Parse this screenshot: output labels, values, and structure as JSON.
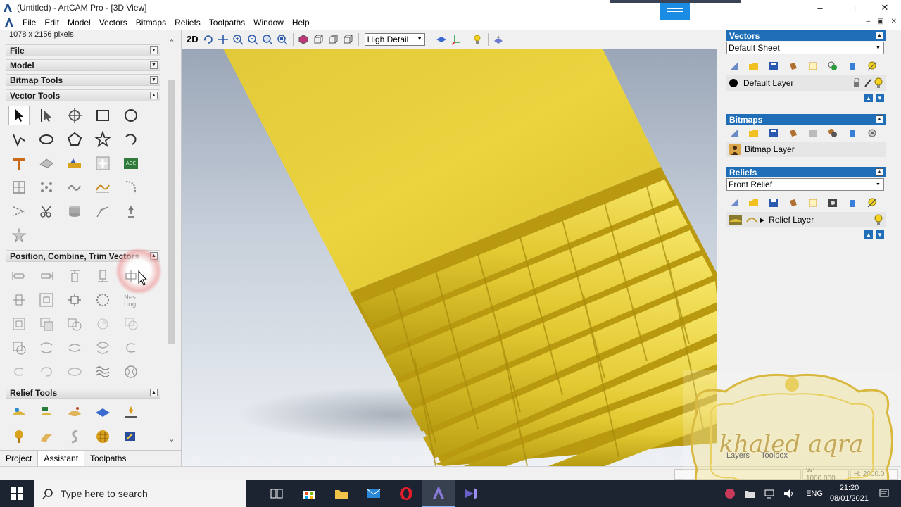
{
  "window": {
    "title": "(Untitled) - ArtCAM Pro - [3D View]",
    "controls": [
      "–",
      "□",
      "✕"
    ],
    "mdi_controls": [
      "–",
      "▣",
      "✕"
    ]
  },
  "menu": {
    "items": [
      "File",
      "Edit",
      "Model",
      "Vectors",
      "Bitmaps",
      "Reliefs",
      "Toolpaths",
      "Window",
      "Help"
    ]
  },
  "left_panel": {
    "pixel_info": "1078 x 2156 pixels",
    "sections": {
      "file": "File",
      "model": "Model",
      "bitmap_tools": "Bitmap Tools",
      "vector_tools": "Vector Tools",
      "position_tools": "Position, Combine, Trim Vectors",
      "relief_tools": "Relief Tools"
    },
    "nest_label": "Nes\nting",
    "bottom_tabs": [
      "Project",
      "Assistant",
      "Toolpaths"
    ]
  },
  "view_toolbar": {
    "mode_label": "2D",
    "detail_level": "High Detail"
  },
  "right_panel": {
    "vectors": {
      "header": "Vectors",
      "sheet": "Default Sheet",
      "layer": "Default Layer"
    },
    "bitmaps": {
      "header": "Bitmaps",
      "layer": "Bitmap Layer"
    },
    "reliefs": {
      "header": "Reliefs",
      "relief": "Front Relief",
      "layer": "Relief Layer"
    }
  },
  "statusbar": {
    "width_field": "W: 1000.000",
    "height_field": "H: 2000.0"
  },
  "taskbar": {
    "search_placeholder": "Type here to search",
    "language": "ENG",
    "time": "21:20",
    "date": "08/01/2021"
  },
  "watermark": {
    "text": "khaled aqra",
    "tabs": [
      "Layers",
      "Toolbox"
    ]
  },
  "colors": {
    "accent_blue": "#1f6eb7",
    "relief_gold": "#e6cf3a",
    "taskbar": "#1c2431"
  }
}
